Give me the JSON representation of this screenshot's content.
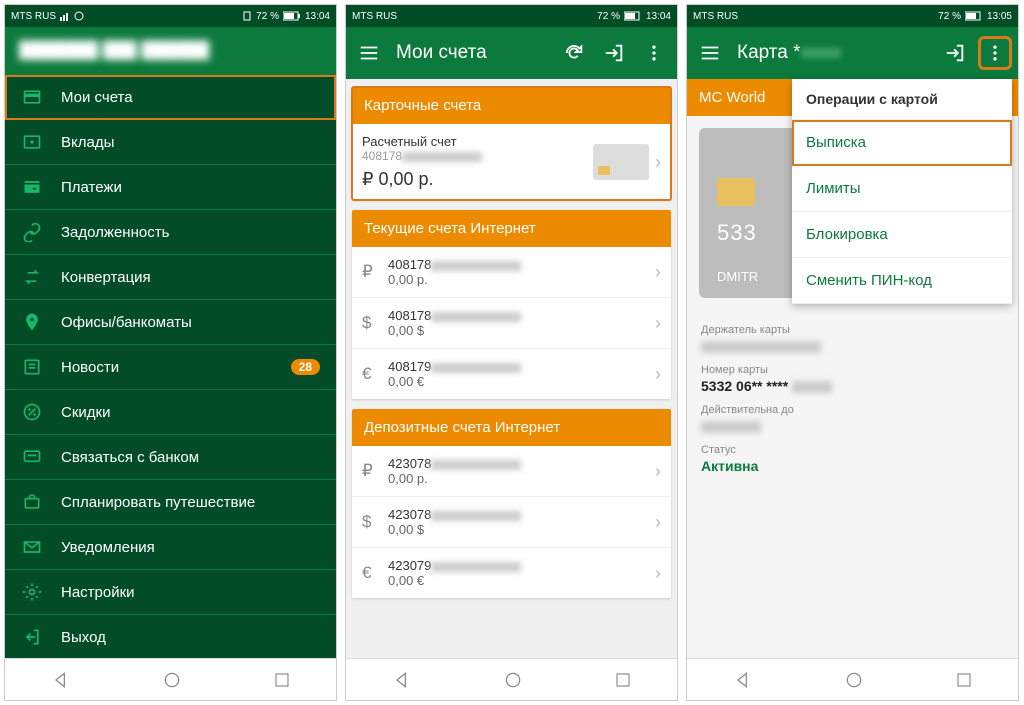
{
  "status": {
    "carrier": "MTS RUS",
    "battery_pct": "72 %",
    "time1": "13:04",
    "time3": "13:05"
  },
  "screen1": {
    "user_header": "███████ ███ ██████",
    "menu": [
      {
        "label": "Мои счета",
        "active": true
      },
      {
        "label": "Вклады"
      },
      {
        "label": "Платежи"
      },
      {
        "label": "Задолженность"
      },
      {
        "label": "Конвертация"
      },
      {
        "label": "Офисы/банкоматы"
      },
      {
        "label": "Новости",
        "badge": "28"
      },
      {
        "label": "Скидки"
      },
      {
        "label": "Связаться с банком"
      },
      {
        "label": "Спланировать путешествие"
      },
      {
        "label": "Уведомления"
      },
      {
        "label": "Настройки"
      },
      {
        "label": "Выход"
      }
    ]
  },
  "screen2": {
    "title": "Мои счета",
    "card_section": "Карточные счета",
    "main_account": {
      "name": "Расчетный счет",
      "number": "408178",
      "amount": "₽  0,00 р."
    },
    "internet_section": "Текущие счета Интернет",
    "internet_accounts": [
      {
        "cur": "₽",
        "num": "408178",
        "bal": "0,00 р."
      },
      {
        "cur": "$",
        "num": "408178",
        "bal": "0,00 $"
      },
      {
        "cur": "€",
        "num": "408179",
        "bal": "0,00 €"
      }
    ],
    "deposit_section": "Депозитные счета Интернет",
    "deposit_accounts": [
      {
        "cur": "₽",
        "num": "423078",
        "bal": "0,00 р."
      },
      {
        "cur": "$",
        "num": "423078",
        "bal": "0,00 $"
      },
      {
        "cur": "€",
        "num": "423079",
        "bal": "0,00 €"
      }
    ]
  },
  "screen3": {
    "title": "Карта *",
    "card_type": "MC World",
    "card_num_short": "533",
    "card_holder": "DMITR",
    "dropdown_head": "Операции с картой",
    "dropdown_items": [
      "Выписка",
      "Лимиты",
      "Блокировка",
      "Сменить ПИН-код"
    ],
    "details": {
      "holder_lbl": "Держатель карты",
      "holder_val": "████████",
      "num_lbl": "Номер карты",
      "num_val": "5332 06** ****",
      "valid_lbl": "Действительна до",
      "valid_val": "██████",
      "status_lbl": "Статус",
      "status_val": "Активна"
    }
  }
}
